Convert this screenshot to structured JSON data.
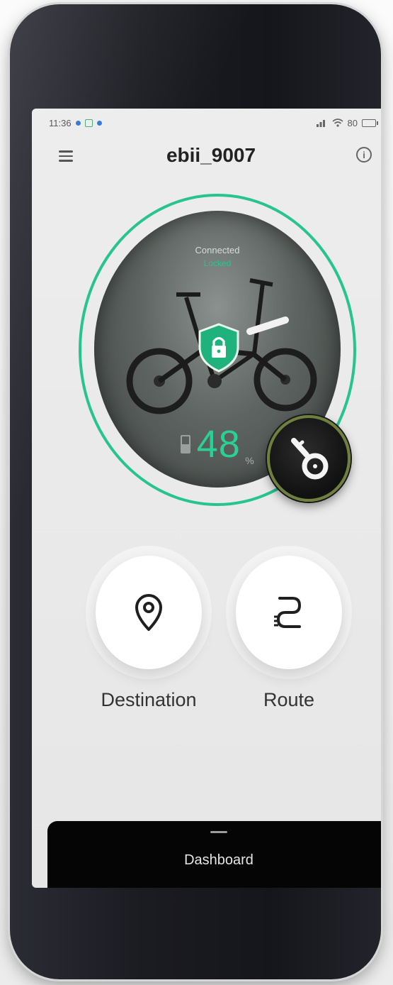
{
  "status_bar": {
    "time": "11:36",
    "right_icons": [
      "signal-icon",
      "wifi-icon",
      "battery-icon"
    ],
    "battery_text": "80"
  },
  "header": {
    "title": "ebii_9007",
    "info_glyph": "i"
  },
  "bike": {
    "connection_status": "Connected",
    "lock_status": "Locked",
    "battery_percent": "48",
    "battery_unit": "%"
  },
  "actions": {
    "destination_label": "Destination",
    "route_label": "Route"
  },
  "dashboard": {
    "label": "Dashboard"
  },
  "colors": {
    "accent_green": "#27c48f",
    "battery_green": "#2ccf94",
    "key_ring": "#6f7f3d",
    "screen_bg": "#ededed"
  }
}
